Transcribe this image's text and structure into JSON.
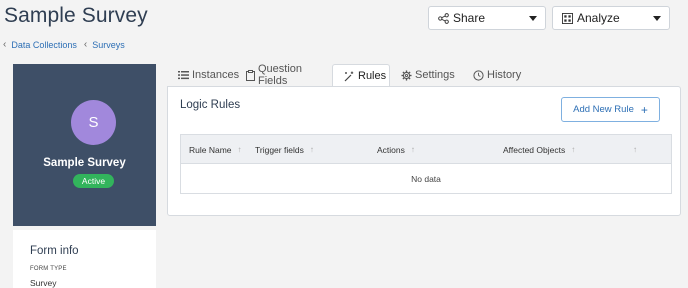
{
  "header": {
    "title": "Sample Survey",
    "share_label": "Share",
    "analyze_label": "Analyze"
  },
  "breadcrumb": [
    "Data Collections",
    "Surveys"
  ],
  "profile": {
    "avatar_letter": "S",
    "name": "Sample Survey",
    "status": "Active"
  },
  "form_info": {
    "title": "Form info",
    "type_label": "FORM TYPE",
    "type_value": "Survey"
  },
  "tabs": [
    {
      "label": "Instances",
      "icon": "list-icon"
    },
    {
      "label": "Question Fields",
      "icon": "clipboard-icon"
    },
    {
      "label": "Rules",
      "icon": "magic-wand-icon",
      "active": true
    },
    {
      "label": "Settings",
      "icon": "gear-icon"
    },
    {
      "label": "History",
      "icon": "clock-icon"
    }
  ],
  "rules": {
    "title": "Logic Rules",
    "add_label": "Add New Rule",
    "columns": [
      "Rule Name",
      "Trigger fields",
      "Actions",
      "Affected Objects"
    ],
    "empty_text": "No data"
  },
  "colors": {
    "sidebar_bg": "#3e4f67",
    "avatar_bg": "#a188dc",
    "status_green": "#32b45c",
    "link_blue": "#2d6fb5"
  }
}
